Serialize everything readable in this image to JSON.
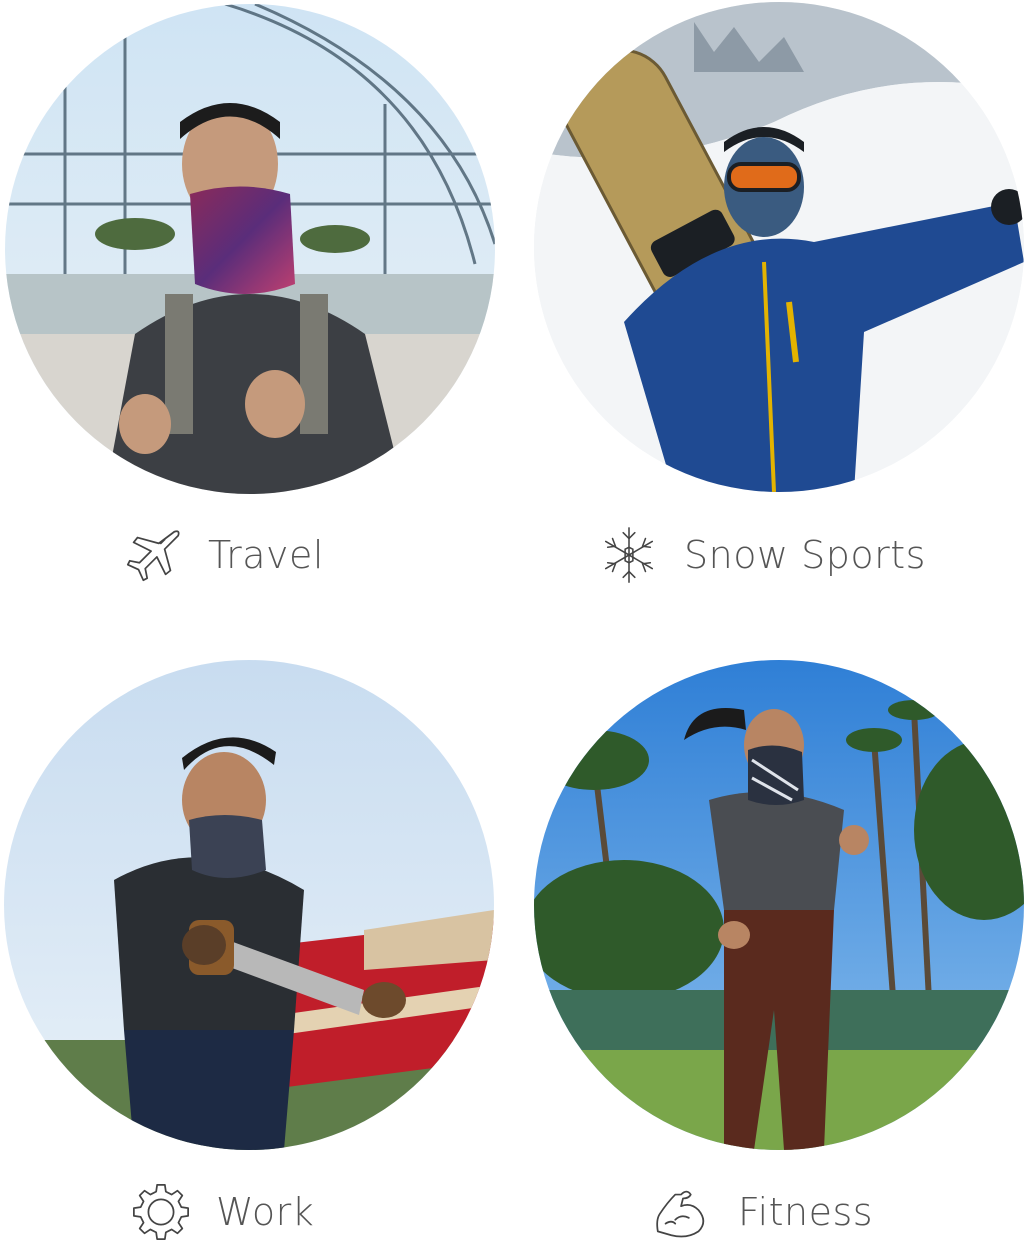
{
  "tiles": [
    {
      "label": "Travel",
      "icon": "airplane-icon"
    },
    {
      "label": "Snow Sports",
      "icon": "snowflake-icon"
    },
    {
      "label": "Work",
      "icon": "gear-icon"
    },
    {
      "label": "Fitness",
      "icon": "flexed-arm-icon"
    }
  ],
  "colors": {
    "text": "#555555",
    "icon_stroke": "#444444",
    "background": "#ffffff"
  }
}
